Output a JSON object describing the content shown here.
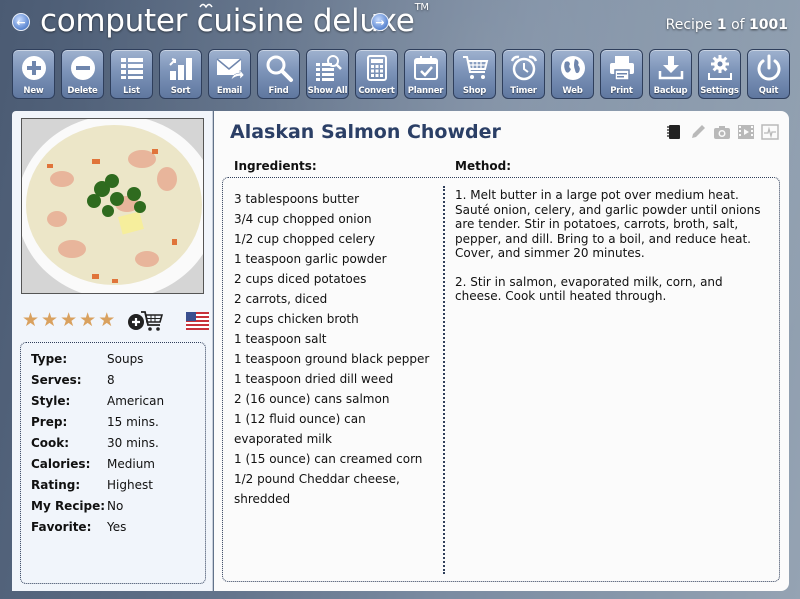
{
  "header": {
    "app_title": "computer cuisine deluxe",
    "trademark": "TM",
    "counter_prefix": "Recipe ",
    "current": "1",
    "counter_of": " of ",
    "total": "1001"
  },
  "toolbar": [
    {
      "label": "New",
      "icon": "plus-circle-icon"
    },
    {
      "label": "Delete",
      "icon": "minus-circle-icon"
    },
    {
      "label": "List",
      "icon": "list-icon"
    },
    {
      "label": "Sort",
      "icon": "bar-chart-sort-icon"
    },
    {
      "label": "Email",
      "icon": "envelope-forward-icon"
    },
    {
      "label": "Find",
      "icon": "magnifier-icon"
    },
    {
      "label": "Show All",
      "icon": "list-search-icon"
    },
    {
      "label": "Convert",
      "icon": "calculator-icon"
    },
    {
      "label": "Planner",
      "icon": "calendar-check-icon"
    },
    {
      "label": "Shop",
      "icon": "shopping-cart-icon"
    },
    {
      "label": "Timer",
      "icon": "alarm-clock-icon"
    },
    {
      "label": "Web",
      "icon": "globe-icon"
    },
    {
      "label": "Print",
      "icon": "printer-icon"
    },
    {
      "label": "Backup",
      "icon": "download-tray-icon"
    },
    {
      "label": "Settings",
      "icon": "gear-icon"
    },
    {
      "label": "Quit",
      "icon": "power-icon"
    }
  ],
  "recipe": {
    "title": "Alaskan Salmon Chowder",
    "rating_stars": 5,
    "rating_max": 5,
    "star_color": "#d9a15f",
    "title_color": "#2b3f66",
    "info": [
      {
        "key": "Type:",
        "value": "Soups"
      },
      {
        "key": "Serves:",
        "value": "8"
      },
      {
        "key": "Style:",
        "value": "American"
      },
      {
        "key": "Prep:",
        "value": "15 mins."
      },
      {
        "key": "Cook:",
        "value": "30 mins."
      },
      {
        "key": "Calories:",
        "value": "Medium"
      },
      {
        "key": "Rating:",
        "value": "Highest"
      },
      {
        "key": "My Recipe:",
        "value": "No"
      },
      {
        "key": "Favorite:",
        "value": "Yes"
      }
    ],
    "ingredients_heading": "Ingredients:",
    "method_heading": "Method:",
    "ingredients": [
      "3 tablespoons butter",
      "3/4 cup chopped onion",
      "1/2 cup chopped celery",
      "1 teaspoon garlic powder",
      "2 cups diced potatoes",
      "2 carrots, diced",
      "2 cups chicken broth",
      "1 teaspoon salt",
      "1 teaspoon ground black pepper",
      "1 teaspoon dried dill weed",
      "2 (16 ounce) cans salmon",
      "1 (12 fluid ounce) can evaporated milk",
      "1 (15 ounce) can creamed corn",
      "1/2 pound Cheddar cheese, shredded"
    ],
    "method": [
      "1. Melt butter in a large pot over medium heat. Sauté onion, celery, and garlic powder until onions are tender. Stir in potatoes, carrots, broth, salt, pepper, and dill. Bring to a boil, and reduce heat. Cover, and simmer 20 minutes.",
      "2. Stir in salmon, evaporated milk, corn, and cheese. Cook until heated through."
    ]
  },
  "recipe_tools": [
    {
      "icon": "notebook-icon",
      "active": true
    },
    {
      "icon": "pencil-icon",
      "active": false
    },
    {
      "icon": "camera-icon",
      "active": false
    },
    {
      "icon": "video-icon",
      "active": false
    },
    {
      "icon": "nutrition-chart-icon",
      "active": false
    }
  ]
}
